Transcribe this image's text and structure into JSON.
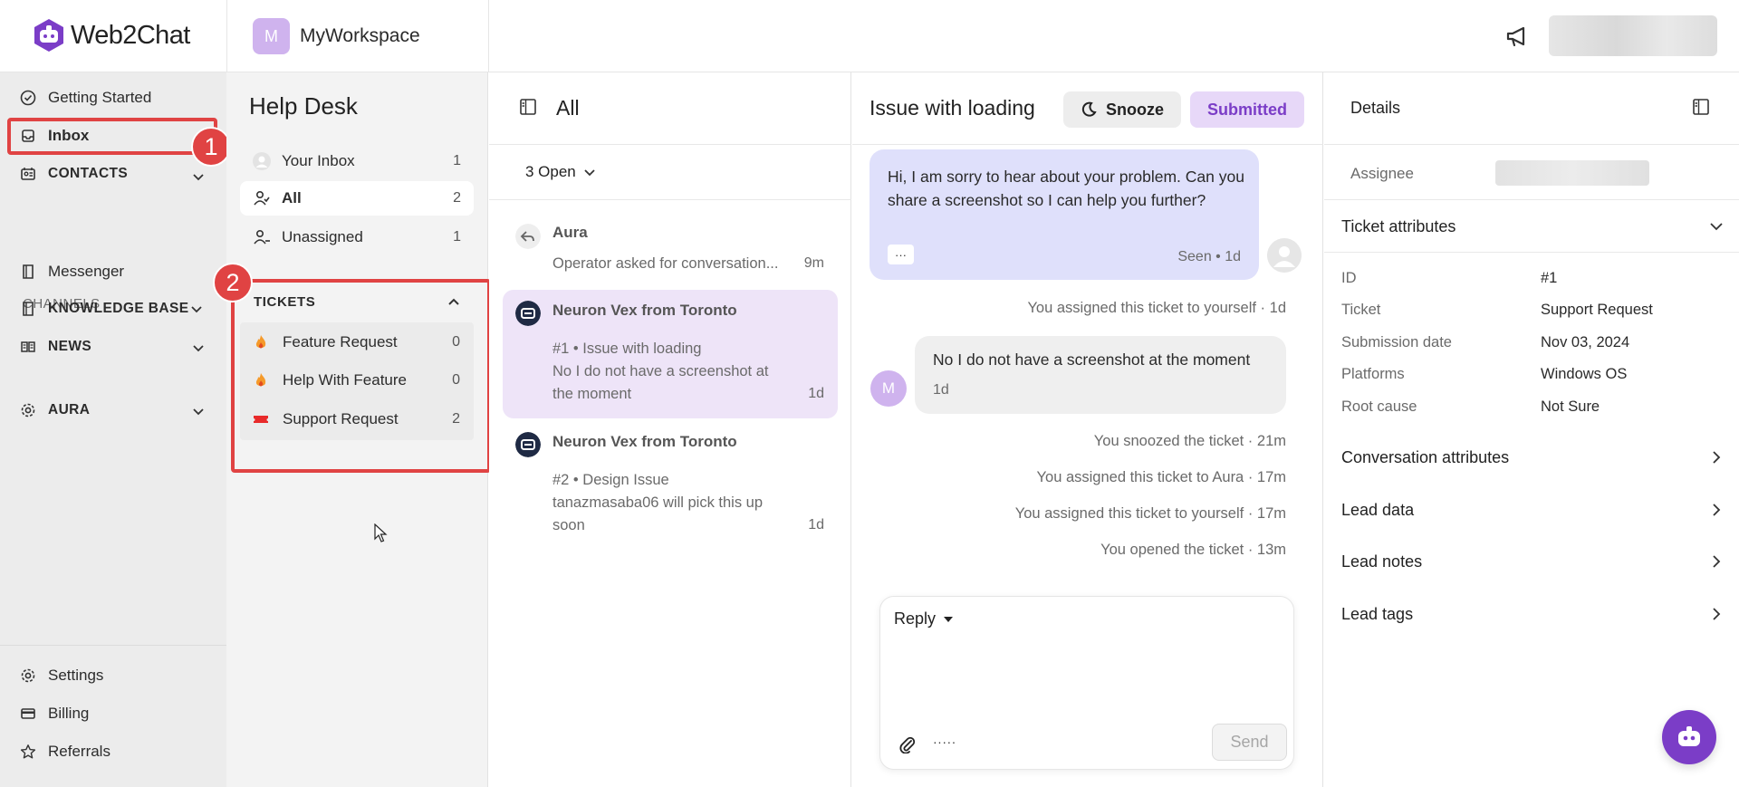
{
  "app": {
    "logo_text": "Web2Chat",
    "workspace_initial": "M",
    "workspace_name": "MyWorkspace"
  },
  "leftnav": {
    "getting_started": "Getting Started",
    "inbox": "Inbox",
    "contacts": "CONTACTS",
    "channels_label": "CHANNELS",
    "messenger": "Messenger",
    "knowledge_base": "KNOWLEDGE BASE",
    "news": "NEWS",
    "aura": "AURA",
    "settings": "Settings",
    "billing": "Billing",
    "referrals": "Referrals"
  },
  "annotations": {
    "one": "1",
    "two": "2"
  },
  "helpdesk": {
    "title": "Help Desk",
    "items": [
      {
        "label": "Your Inbox",
        "count": "1"
      },
      {
        "label": "All",
        "count": "2"
      },
      {
        "label": "Unassigned",
        "count": "1"
      }
    ],
    "tickets_label": "TICKETS",
    "tickets": [
      {
        "label": "Feature Request",
        "count": "0"
      },
      {
        "label": "Help With Feature",
        "count": "0"
      },
      {
        "label": "Support Request",
        "count": "2"
      }
    ]
  },
  "convlist": {
    "title": "All",
    "filter": "3 Open",
    "conversations": [
      {
        "name": "Aura",
        "line1": "Operator asked for conversation...",
        "time": "9m"
      },
      {
        "name": "Neuron Vex from Toronto",
        "line1": "#1 • Issue with loading",
        "line2": "No I do not have a screenshot at",
        "line3": "the moment",
        "time": "1d"
      },
      {
        "name": "Neuron Vex from Toronto",
        "line1": "#2 • Design Issue",
        "line2": "tanazmasaba06 will pick this up",
        "line3": "soon",
        "time": "1d"
      }
    ]
  },
  "chat": {
    "title": "Issue with loading",
    "snooze": "Snooze",
    "status": "Submitted",
    "operator_message": "Hi, I am sorry to hear about your problem. Can you share a screenshot so I can help you further?",
    "operator_dots": "···",
    "operator_meta": "Seen • 1d",
    "events": [
      "You assigned this ticket to yourself · 1d",
      "You snoozed the ticket · 21m",
      "You assigned this ticket to Aura · 17m",
      "You assigned this ticket to yourself · 17m",
      "You opened the ticket · 13m"
    ],
    "lead_initial": "M",
    "lead_message": "No I do not have a screenshot at the moment",
    "lead_time": "1d",
    "reply_mode": "Reply",
    "more": "·····",
    "send": "Send"
  },
  "details": {
    "title": "Details",
    "assignee_label": "Assignee",
    "ticket_attributes": "Ticket attributes",
    "attributes": [
      {
        "key": "ID",
        "value": "#1"
      },
      {
        "key": "Ticket",
        "value": "Support Request"
      },
      {
        "key": "Submission date",
        "value": "Nov 03, 2024"
      },
      {
        "key": "Platforms",
        "value": "Windows OS"
      },
      {
        "key": "Root cause",
        "value": "Not Sure"
      }
    ],
    "sections": [
      "Conversation attributes",
      "Lead data",
      "Lead notes",
      "Lead tags"
    ]
  },
  "colors": {
    "accent": "#7b3dc7",
    "highlight": "#e04343",
    "operator_bubble": "#dfe0fb",
    "selected_conv": "#eee4f8"
  }
}
